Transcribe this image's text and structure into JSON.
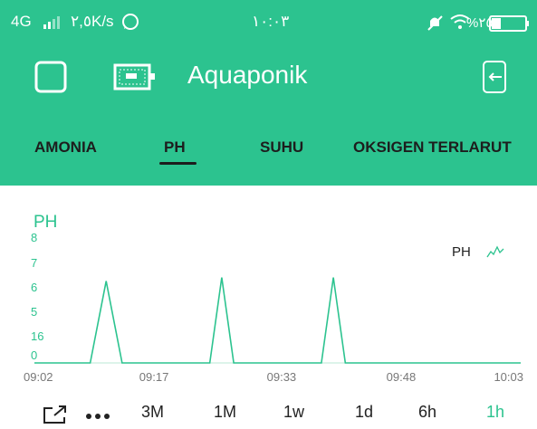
{
  "status_bar": {
    "network": "4G",
    "speed": "٢,٥K/s",
    "time": "١٠:٠٣",
    "battery": "%٢٥"
  },
  "app_bar": {
    "title": "Aquaponik"
  },
  "tabs": [
    {
      "label": "AMONIA",
      "active": false
    },
    {
      "label": "PH",
      "active": true
    },
    {
      "label": "SUHU",
      "active": false
    },
    {
      "label": "OKSIGEN TERLARUT",
      "active": false
    }
  ],
  "colors": {
    "accent": "#2cc38f",
    "text": "#1d1d1d"
  },
  "chart_data": {
    "type": "line",
    "title": "PH",
    "series": [
      {
        "name": "PH",
        "points": [
          [
            "09:02",
            0
          ],
          [
            "09:09",
            0
          ],
          [
            "09:11",
            6.8
          ],
          [
            "09:13",
            0
          ],
          [
            "09:24",
            0
          ],
          [
            "09:25.5",
            7.1
          ],
          [
            "09:27",
            0
          ],
          [
            "09:38",
            0
          ],
          [
            "09:39.5",
            7.1
          ],
          [
            "09:41",
            0
          ],
          [
            "10:03",
            0
          ]
        ]
      }
    ],
    "x_ticks": [
      "09:02",
      "09:17",
      "09:33",
      "09:48",
      "10:03"
    ],
    "y_ticks": [
      "8",
      "7",
      "6",
      "5",
      "16",
      "0"
    ],
    "legend": "top-right",
    "grid": false
  },
  "range_buttons": [
    {
      "label": "3M",
      "active": false
    },
    {
      "label": "1M",
      "active": false
    },
    {
      "label": "1w",
      "active": false
    },
    {
      "label": "1d",
      "active": false
    },
    {
      "label": "6h",
      "active": false
    },
    {
      "label": "1h",
      "active": true
    }
  ],
  "icons": {
    "expand": "expand-icon",
    "more": "more-icon",
    "checkbox": "square-icon",
    "device": "device-icon",
    "logout": "logout-icon"
  }
}
